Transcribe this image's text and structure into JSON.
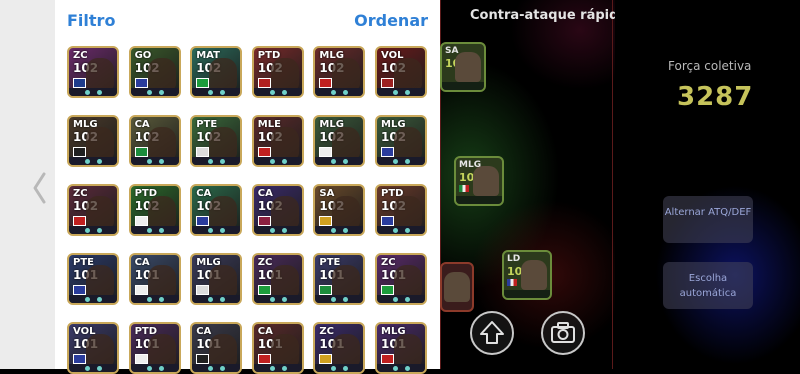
{
  "panel": {
    "filter_label": "Filtro",
    "sort_label": "Ordenar"
  },
  "cards": [
    {
      "pos": "ZC",
      "rating": "102",
      "color": "#6a2a6a",
      "flag": "#1e3c8c"
    },
    {
      "pos": "GO",
      "rating": "102",
      "color": "#3a5a2a",
      "flag": "#2a3c9c"
    },
    {
      "pos": "MAT",
      "rating": "102",
      "color": "#2a6a5a",
      "flag": "#1c9c3c"
    },
    {
      "pos": "PTD",
      "rating": "102",
      "color": "#7a2a2a",
      "flag": "#b02020"
    },
    {
      "pos": "MLG",
      "rating": "102",
      "color": "#6a2a2a",
      "flag": "#c02020"
    },
    {
      "pos": "VOL",
      "rating": "102",
      "color": "#6a1a1a",
      "flag": "#9c2020"
    },
    {
      "pos": "MLG",
      "rating": "102",
      "color": "#4a3a2a",
      "flag": "#202020"
    },
    {
      "pos": "CA",
      "rating": "102",
      "color": "#5a5a3a",
      "flag": "#1c8c3c"
    },
    {
      "pos": "PTE",
      "rating": "102",
      "color": "#3a6a3a",
      "flag": "#dcdcdc"
    },
    {
      "pos": "MLE",
      "rating": "102",
      "color": "#5a2a2a",
      "flag": "#c02020"
    },
    {
      "pos": "MLG",
      "rating": "102",
      "color": "#3a5a3a",
      "flag": "#eeeeee"
    },
    {
      "pos": "MLG",
      "rating": "102",
      "color": "#3a5a3a",
      "flag": "#2a3c9c"
    },
    {
      "pos": "ZC",
      "rating": "102",
      "color": "#5a2a3a",
      "flag": "#c02020"
    },
    {
      "pos": "PTD",
      "rating": "102",
      "color": "#2a6a2a",
      "flag": "#eeeeee"
    },
    {
      "pos": "CA",
      "rating": "102",
      "color": "#2a6a4a",
      "flag": "#2a3c9c"
    },
    {
      "pos": "CA",
      "rating": "102",
      "color": "#3a2a6a",
      "flag": "#8c2040"
    },
    {
      "pos": "SA",
      "rating": "102",
      "color": "#6a4a2a",
      "flag": "#d0a020"
    },
    {
      "pos": "PTD",
      "rating": "102",
      "color": "#6a3a2a",
      "flag": "#2a3c9c"
    },
    {
      "pos": "PTE",
      "rating": "101",
      "color": "#2a3a6a",
      "flag": "#2a3c9c"
    },
    {
      "pos": "CA",
      "rating": "101",
      "color": "#3a4a6a",
      "flag": "#eeeeee"
    },
    {
      "pos": "MLG",
      "rating": "101",
      "color": "#3a3a5a",
      "flag": "#dcdcdc"
    },
    {
      "pos": "ZC",
      "rating": "101",
      "color": "#4a2a5a",
      "flag": "#1c9c3c"
    },
    {
      "pos": "PTE",
      "rating": "101",
      "color": "#3a3a6a",
      "flag": "#1c8c3c"
    },
    {
      "pos": "ZC",
      "rating": "101",
      "color": "#5a2a6a",
      "flag": "#1c9c3c"
    },
    {
      "pos": "VOL",
      "rating": "101",
      "color": "#3a3a6a",
      "flag": "#2a3c9c"
    },
    {
      "pos": "PTD",
      "rating": "101",
      "color": "#4a2a5a",
      "flag": "#eeeeee"
    },
    {
      "pos": "CA",
      "rating": "101",
      "color": "#3a3a4a",
      "flag": "#202020"
    },
    {
      "pos": "CA",
      "rating": "101",
      "color": "#5a2a2a",
      "flag": "#c02020"
    },
    {
      "pos": "ZC",
      "rating": "101",
      "color": "#3a2a6a",
      "flag": "#d0a020"
    },
    {
      "pos": "MLG",
      "rating": "101",
      "color": "#4a2a6a",
      "flag": "#c02020"
    }
  ],
  "formation": {
    "title": "Contra-ataque rápido",
    "players": [
      {
        "pos": "SA",
        "rating": "107"
      },
      {
        "pos": "MLG",
        "rating": "106"
      },
      {
        "pos": "LD",
        "rating": "107"
      }
    ]
  },
  "team": {
    "strength_label": "Força coletiva",
    "strength_value": "3287"
  },
  "buttons": {
    "toggle_label": "Alternar ATQ/DEF",
    "auto_label": "Escolha automática"
  },
  "colors": {
    "accent_blue": "#2f80d6",
    "strength_yellow": "#c6c35b"
  }
}
